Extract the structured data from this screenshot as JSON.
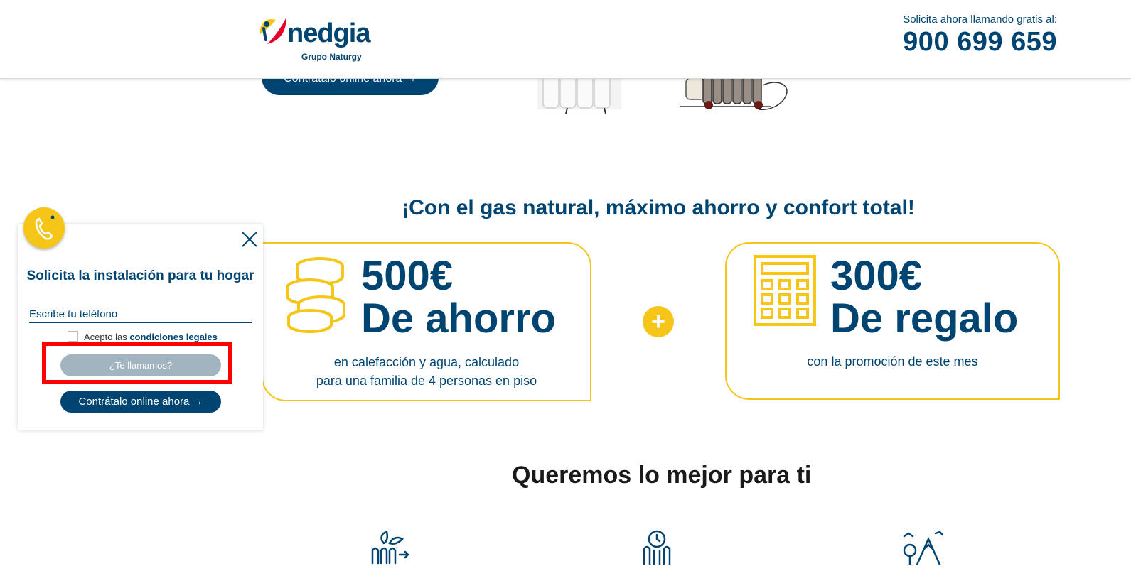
{
  "header": {
    "logo_word": "nedgia",
    "logo_sub": "Grupo Naturgy",
    "call_label": "Solicita ahora llamando gratis al:",
    "call_number": "900 699 659"
  },
  "hero": {
    "cta_label": "Contrátalo online ahora →"
  },
  "promo": {
    "headline": "¡Con el gas natural, máximo ahorro y confort total!",
    "card1": {
      "amount": "500€",
      "label": "De ahorro",
      "desc_line1": "en calefacción y agua, calculado",
      "desc_line2": "para una familia de 4 personas en piso"
    },
    "plus": "+",
    "card2": {
      "amount": "300€",
      "label": "De regalo",
      "desc_line1": "con la promoción de este mes"
    }
  },
  "benefits": {
    "title": "Queremos lo mejor para ti"
  },
  "widget": {
    "title": "Solicita la instalación para tu hogar",
    "phone_placeholder": "Escribe tu teléfono",
    "legal_prefix": "Acepto las ",
    "legal_link": "condiciones legales",
    "callme_label": "¿Te llamamos?",
    "contract_label": "Contrátalo online ahora →"
  },
  "colors": {
    "brand_blue": "#004571",
    "accent_yellow": "#f5c518",
    "disabled_button": "#a2b4c0",
    "highlight_red": "#ff0000"
  },
  "icons": [
    "phone-icon",
    "close-icon",
    "coins-icon",
    "calculator-icon",
    "plus-icon",
    "radiator-icon",
    "oil-heater-icon",
    "eco-heating-icon",
    "clock-heating-icon",
    "outdoor-icon"
  ]
}
